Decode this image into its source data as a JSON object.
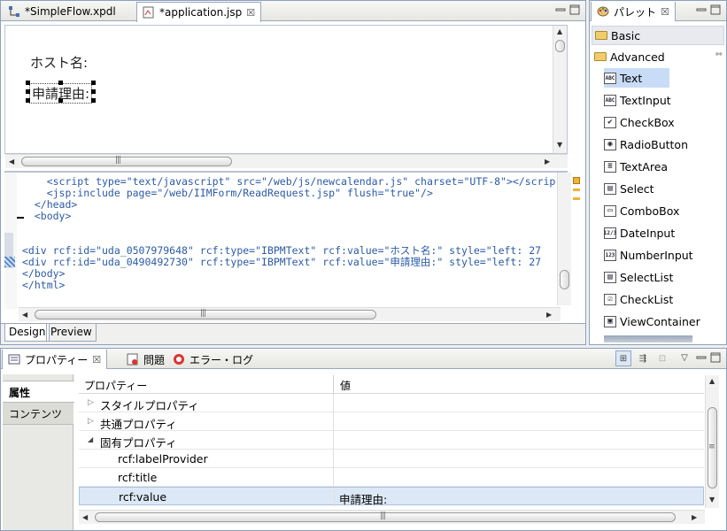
{
  "editor": {
    "tabs": [
      {
        "label": "*SimpleFlow.xpdl",
        "icon": "flow-icon"
      },
      {
        "label": "*application.jsp",
        "icon": "jsp-file-icon",
        "close": "☒"
      }
    ],
    "canvas": {
      "host_label": "ホスト名:",
      "reason_label": "申請理由:"
    },
    "code_lines": [
      "    <script type=\"text/javascript\" src=\"/web/js/newcalendar.js\" charset=\"UTF-8\"></scrip",
      "    <jsp:include page=\"/web/IIMForm/ReadRequest.jsp\" flush=\"true\"/>",
      "  </head>",
      "  <body>",
      "",
      "",
      "<div rcf:id=\"uda_0507979648\" rcf:type=\"IBPMText\" rcf:value=\"ホスト名:\" style=\"left: 27",
      "<div rcf:id=\"uda_0490492730\" rcf:type=\"IBPMText\" rcf:value=\"申請理由:\" style=\"left: 27",
      "</body>",
      "</html>"
    ],
    "bottom_tabs": [
      "Design",
      "Preview"
    ]
  },
  "palette": {
    "title": "パレット",
    "close": "☒",
    "drawers": [
      "Basic",
      "Advanced"
    ],
    "items": [
      {
        "label": "Text",
        "icon": "text-icon",
        "glyph": "ABC"
      },
      {
        "label": "TextInput",
        "icon": "textinput-icon",
        "glyph": "ABC"
      },
      {
        "label": "CheckBox",
        "icon": "checkbox-icon",
        "glyph": "✔"
      },
      {
        "label": "RadioButton",
        "icon": "radiobutton-icon",
        "glyph": "◉"
      },
      {
        "label": "TextArea",
        "icon": "textarea-icon",
        "glyph": "≡"
      },
      {
        "label": "Select",
        "icon": "select-icon",
        "glyph": "▤"
      },
      {
        "label": "ComboBox",
        "icon": "combobox-icon",
        "glyph": "▭"
      },
      {
        "label": "DateInput",
        "icon": "dateinput-icon",
        "glyph": "12/3"
      },
      {
        "label": "NumberInput",
        "icon": "numberinput-icon",
        "glyph": "123"
      },
      {
        "label": "SelectList",
        "icon": "selectlist-icon",
        "glyph": "▤"
      },
      {
        "label": "CheckList",
        "icon": "checklist-icon",
        "glyph": "☑"
      },
      {
        "label": "ViewContainer",
        "icon": "viewcontainer-icon",
        "glyph": "▣"
      }
    ]
  },
  "properties": {
    "tabs": [
      {
        "label": "プロパティー",
        "icon": "properties-icon",
        "close": "☒"
      },
      {
        "label": "問題",
        "icon": "problems-icon"
      },
      {
        "label": "エラー・ログ",
        "icon": "error-log-icon"
      }
    ],
    "side_tabs": [
      "属性",
      "コンテンツ"
    ],
    "headers": [
      "プロパティー",
      "値"
    ],
    "rows": [
      {
        "name": "スタイルプロパティ",
        "value": "",
        "toggle": "▷"
      },
      {
        "name": "共通プロパティ",
        "value": "",
        "toggle": "▷"
      },
      {
        "name": "固有プロパティ",
        "value": "",
        "toggle": "◢"
      },
      {
        "name": "rcf:labelProvider",
        "value": ""
      },
      {
        "name": "rcf:title",
        "value": ""
      },
      {
        "name": "rcf:value",
        "value": "申請理由:"
      }
    ]
  },
  "colors": {
    "selection": "#dde8f6",
    "palette_selected": "#c8dcf7",
    "frame": "#8a9fbf"
  }
}
